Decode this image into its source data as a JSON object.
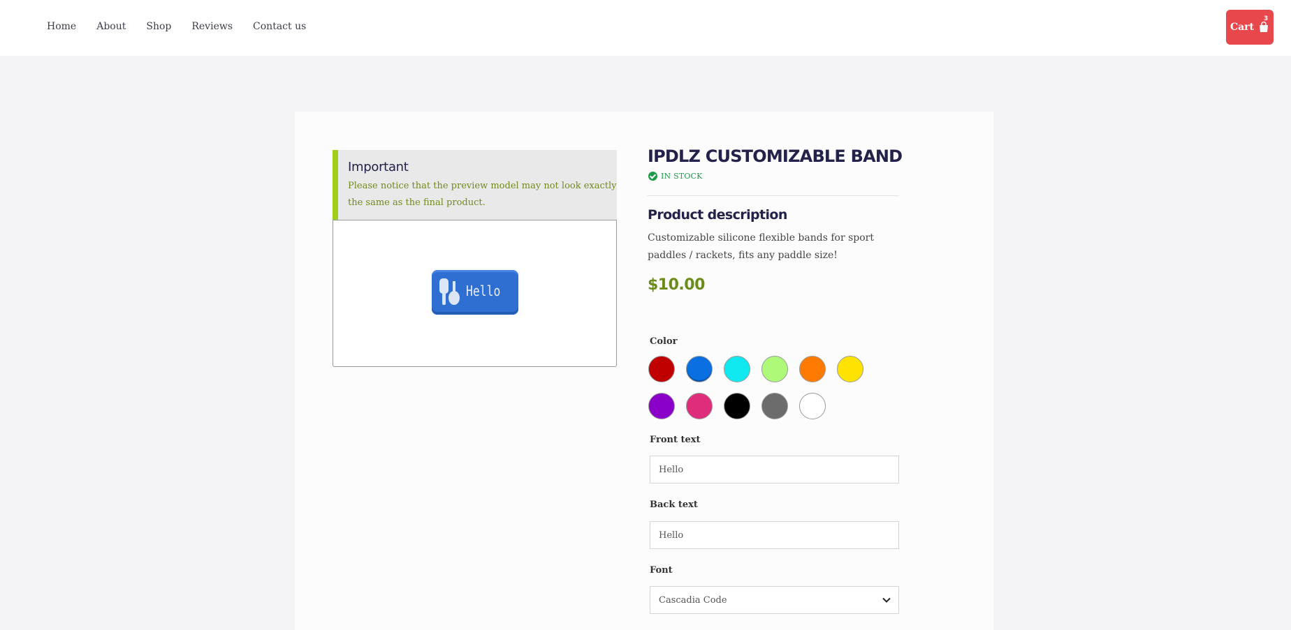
{
  "nav": {
    "items": [
      {
        "label": "Home"
      },
      {
        "label": "About"
      },
      {
        "label": "Shop"
      },
      {
        "label": "Reviews"
      },
      {
        "label": "Contact us"
      }
    ]
  },
  "cart": {
    "label": "Cart",
    "count": "3",
    "icon": "shopping-bag-icon",
    "color": "#e8474c"
  },
  "notice": {
    "title": "Important",
    "text": "Please notice that the preview model may not look exactly the same as the final product.",
    "accent": "#a0cc1a"
  },
  "preview": {
    "band_text": "Hello",
    "band_color": "#2f6fd1"
  },
  "product": {
    "title": "IPDLZ CUSTOMIZABLE BAND",
    "stock": "IN STOCK",
    "description_title": "Product description",
    "description": "Customizable silicone flexible bands for sport paddles / rackets, fits any paddle size!",
    "price": "$10.00"
  },
  "options": {
    "color_label": "Color",
    "colors": [
      "#c00000",
      "#0a6fe0",
      "#0fe8ee",
      "#aefa78",
      "#ff7a00",
      "#ffe300",
      "#8a00c9",
      "#de2d7b",
      "#000000",
      "#6c6c6c",
      "#ffffff"
    ],
    "selected_color": "#0a6fe0",
    "front_label": "Front text",
    "front_value": "Hello",
    "back_label": "Back text",
    "back_value": "Hello",
    "font_label": "Font",
    "font_value": "Cascadia Code"
  }
}
